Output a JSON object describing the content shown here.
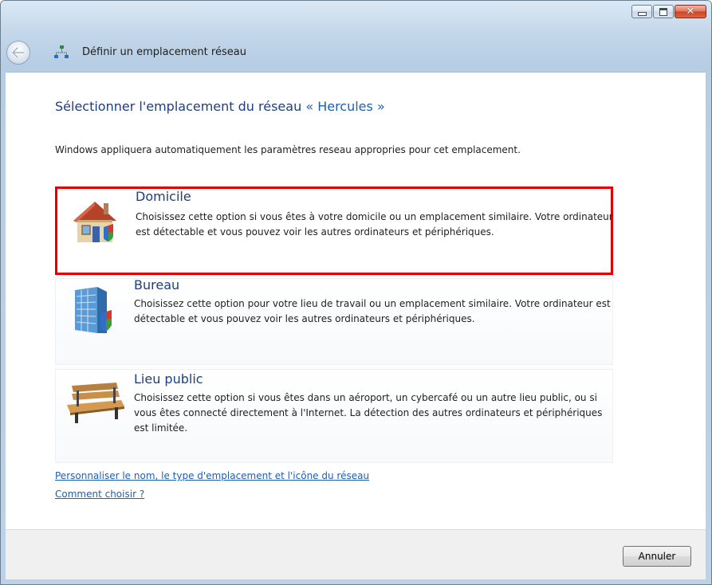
{
  "window": {
    "nav_title": "Définir un emplacement réseau"
  },
  "content": {
    "heading_prefix": "Sélectionner l'emplacement du réseau",
    "network_name": "« Hercules »",
    "description": "Windows appliquera automatiquement les paramètres reseau appropries pour cet emplacement."
  },
  "options": [
    {
      "title": "Domicile",
      "text": "Choisissez cette option si vous êtes à votre domicile ou un emplacement similaire. Votre ordinateur est détectable et vous pouvez voir les autres ordinateurs et périphériques.",
      "icon": "house-icon"
    },
    {
      "title": "Bureau",
      "text": "Choisissez cette option pour votre lieu de travail ou un emplacement similaire. Votre ordinateur est détectable et vous pouvez voir les autres ordinateurs et périphériques.",
      "icon": "office-building-icon"
    },
    {
      "title": "Lieu public",
      "text": "Choisissez cette option si vous êtes dans un aéroport, un cybercafé ou un autre lieu public, ou si vous êtes connecté directement à l'Internet. La détection des autres ordinateurs et périphériques est limitée.",
      "icon": "park-bench-icon"
    }
  ],
  "links": {
    "customize": "Personnaliser le nom, le type d'emplacement et l'icône du réseau",
    "how_to_choose": "Comment choisir ?"
  },
  "buttons": {
    "cancel": "Annuler"
  },
  "colors": {
    "selection_border": "#e10000",
    "heading": "#1f3f7a",
    "link": "#1f5fb0"
  }
}
